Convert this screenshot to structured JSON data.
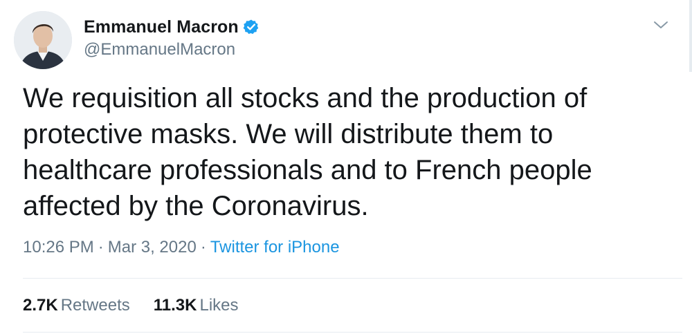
{
  "user": {
    "display_name": "Emmanuel Macron",
    "handle": "@EmmanuelMacron",
    "verified": true,
    "avatar_icon": "profile-photo-icon"
  },
  "tweet": {
    "text": "We requisition all stocks and the production of protective masks. We will distribute them to healthcare professionals and to French people affected by the Coronavirus.",
    "time": "10:26 PM",
    "separator": "·",
    "date": "Mar 3, 2020",
    "source": "Twitter for iPhone"
  },
  "stats": {
    "retweets_count": "2.7K",
    "retweets_label": "Retweets",
    "likes_count": "11.3K",
    "likes_label": "Likes"
  },
  "colors": {
    "verified_badge": "#1da1f2",
    "link": "#1b95e0",
    "secondary_text": "#657786",
    "primary_text": "#14171a",
    "divider": "#e6ecf0"
  },
  "icons": {
    "menu": "chevron-down-icon",
    "verified": "verified-badge-icon"
  }
}
